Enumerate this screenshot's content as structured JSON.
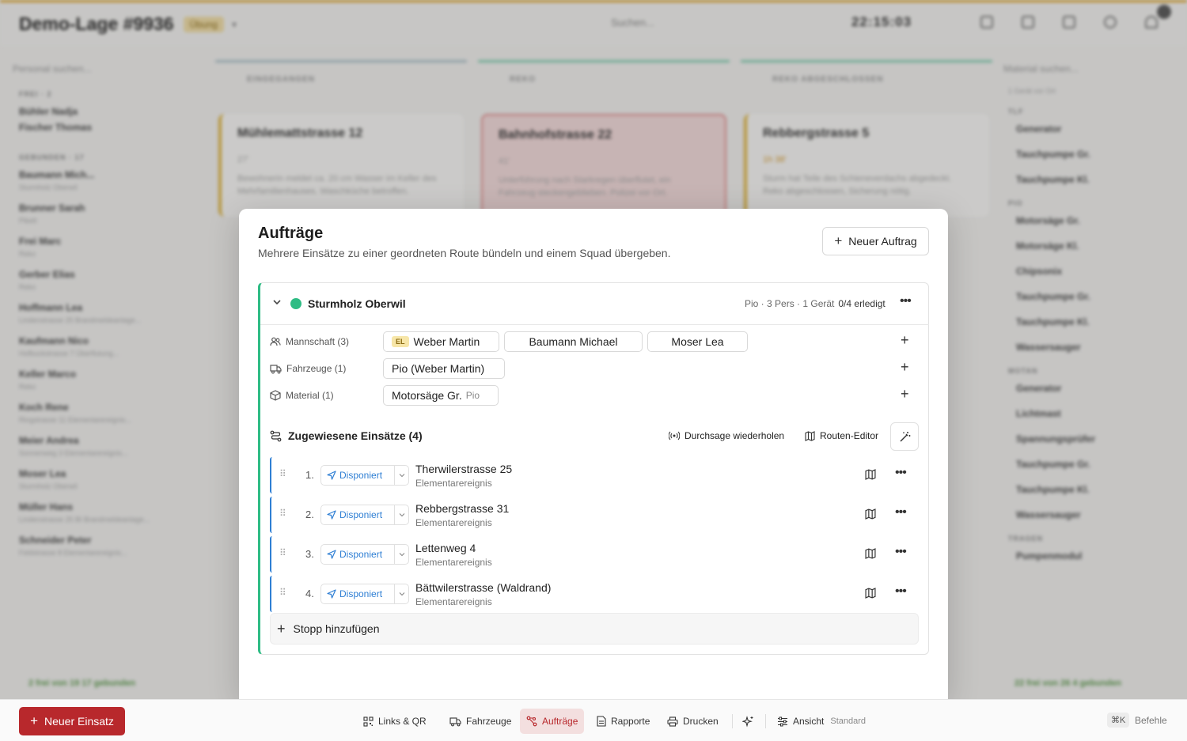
{
  "background": {
    "title": "Demo-Lage #9936",
    "badge": "Übung",
    "search_placeholder": "Suchen...",
    "clock": "22:15:03",
    "left": {
      "search_placeholder": "Personal suchen...",
      "sections": [
        "FREI · 2",
        "GEBUNDEN · 17"
      ],
      "free": [
        "Bühler Nadja",
        "Fischer Thomas"
      ],
      "bound": [
        {
          "name": "Baumann Mich...",
          "sub": "Sturmholz Oberwil"
        },
        {
          "name": "Brunner Sarah",
          "sub": "Pikett"
        },
        {
          "name": "Frei Marc",
          "sub": "Reko"
        },
        {
          "name": "Gerber Elias",
          "sub": "Reko"
        },
        {
          "name": "Hoffmann Lea",
          "sub": "Lindenstrasse 25 Brandmeldeanlage..."
        },
        {
          "name": "Kaufmann Nico",
          "sub": "Hofbuckstrasse 7 Überflutung..."
        },
        {
          "name": "Keller Marco",
          "sub": "Reko"
        },
        {
          "name": "Koch Rene",
          "sub": "Ringstrasse 11 Elementarereignis..."
        },
        {
          "name": "Meier Andrea",
          "sub": "Sonnenweg 3 Elementarereignis..."
        },
        {
          "name": "Moser Lea",
          "sub": "Sturmholz Oberwil"
        },
        {
          "name": "Müller Hans",
          "sub": "Lindenstrasse 25 BI Brandmeldeanlage..."
        },
        {
          "name": "Schneider Peter",
          "sub": "Feldstrasse 8 Elementarereignis..."
        }
      ],
      "status": "2 frei  von 19  17 gebunden"
    },
    "columns": [
      {
        "head": "EINGEGANGEN",
        "card_title": "Mühlemattstrasse 12",
        "card_meta": "27'",
        "card_desc": "Bewohnerin meldet ca. 20 cm Wasser im Keller des Mehrfamilienhauses. Waschküche betroffen."
      },
      {
        "head": "REKO",
        "card_title": "Bahnhofstrasse 22",
        "card_meta": "41'",
        "card_desc": "Unterführung nach Starkregen überflutet, ein Fahrzeug steckengeblieben. Polizei vor Ort."
      },
      {
        "head": "REKO ABGESCHLOSSEN",
        "card_title": "Rebbergstrasse 5",
        "card_meta": "1h 38'",
        "card_desc": "Sturm hat Teile des Schieneverdachs abgedeckt. Reko abgeschlossen, Sicherung nötig."
      }
    ],
    "right": {
      "search_placeholder": "Material suchen...",
      "filter": "1 Gerät vor Ort",
      "sections": [
        {
          "title": "TLF",
          "items": [
            "Generator",
            "Tauchpumpe Gr.",
            "Tauchpumpe Kl."
          ]
        },
        {
          "title": "PIO",
          "items": [
            "Motorsäge Gr.",
            "Motorsäge Kl.",
            "Chipsonix",
            "Tauchpumpe Gr.",
            "Tauchpumpe Kl.",
            "Wassersauger"
          ]
        },
        {
          "title": "MOTAN",
          "items": [
            "Generator",
            "Lichtmast",
            "Spannungsprüfer",
            "Tauchpumpe Gr.",
            "Tauchpumpe Kl.",
            "Wassersauger"
          ]
        },
        {
          "title": "TRAGEN",
          "items": [
            "Pumpenmodul"
          ]
        }
      ],
      "status": "22 frei  von 26  4 gebunden"
    }
  },
  "modal": {
    "title": "Aufträge",
    "subtitle": "Mehrere Einsätze zu einer geordneten Route bündeln und einem Squad übergeben.",
    "new_order_label": "Neuer Auftrag",
    "squad": {
      "name": "Sturmholz Oberwil",
      "status_color": "#2ebc84",
      "meta": "Pio · 3 Pers · 1 Gerät",
      "progress": "0/4 erledigt",
      "crew_label": "Mannschaft (3)",
      "crew": [
        {
          "tag": "EL",
          "name": "Weber Martin"
        },
        {
          "tag": "",
          "name": "Baumann Michael"
        },
        {
          "tag": "",
          "name": "Moser Lea"
        }
      ],
      "vehicles_label": "Fahrzeuge (1)",
      "vehicles": [
        "Pio (Weber Martin)"
      ],
      "material_label": "Material (1)",
      "material": [
        {
          "name": "Motorsäge Gr.",
          "tag": "Pio"
        }
      ],
      "assigned_title": "Zugewiesene Einsätze (4)",
      "repeat_label": "Durchsage wiederholen",
      "route_editor_label": "Routen-Editor",
      "stops": [
        {
          "num": "1.",
          "status": "Disponiert",
          "address": "Therwilerstrasse 25",
          "type": "Elementarereignis"
        },
        {
          "num": "2.",
          "status": "Disponiert",
          "address": "Rebbergstrasse 31",
          "type": "Elementarereignis"
        },
        {
          "num": "3.",
          "status": "Disponiert",
          "address": "Lettenweg 4",
          "type": "Elementarereignis"
        },
        {
          "num": "4.",
          "status": "Disponiert",
          "address": "Bättwilerstrasse (Waldrand)",
          "type": "Elementarereignis"
        }
      ],
      "add_stop_label": "Stopp hinzufügen"
    }
  },
  "toolbar": {
    "new_incident_label": "Neuer Einsatz",
    "items": [
      {
        "label": "Links & QR",
        "icon": "qr-icon"
      },
      {
        "label": "Fahrzeuge",
        "icon": "truck-icon"
      },
      {
        "label": "Aufträge",
        "icon": "route-icon",
        "active": true
      },
      {
        "label": "Rapporte",
        "icon": "document-icon"
      },
      {
        "label": "Drucken",
        "icon": "printer-icon"
      }
    ],
    "view_label": "Ansicht",
    "view_value": "Standard",
    "shortcut": "⌘K",
    "shortcut_label": "Befehle"
  },
  "colors": {
    "accent_red": "#b8282c",
    "squad_green": "#2ebc84",
    "status_blue": "#2f7fd4",
    "warning_yellow": "#e0a21f"
  }
}
